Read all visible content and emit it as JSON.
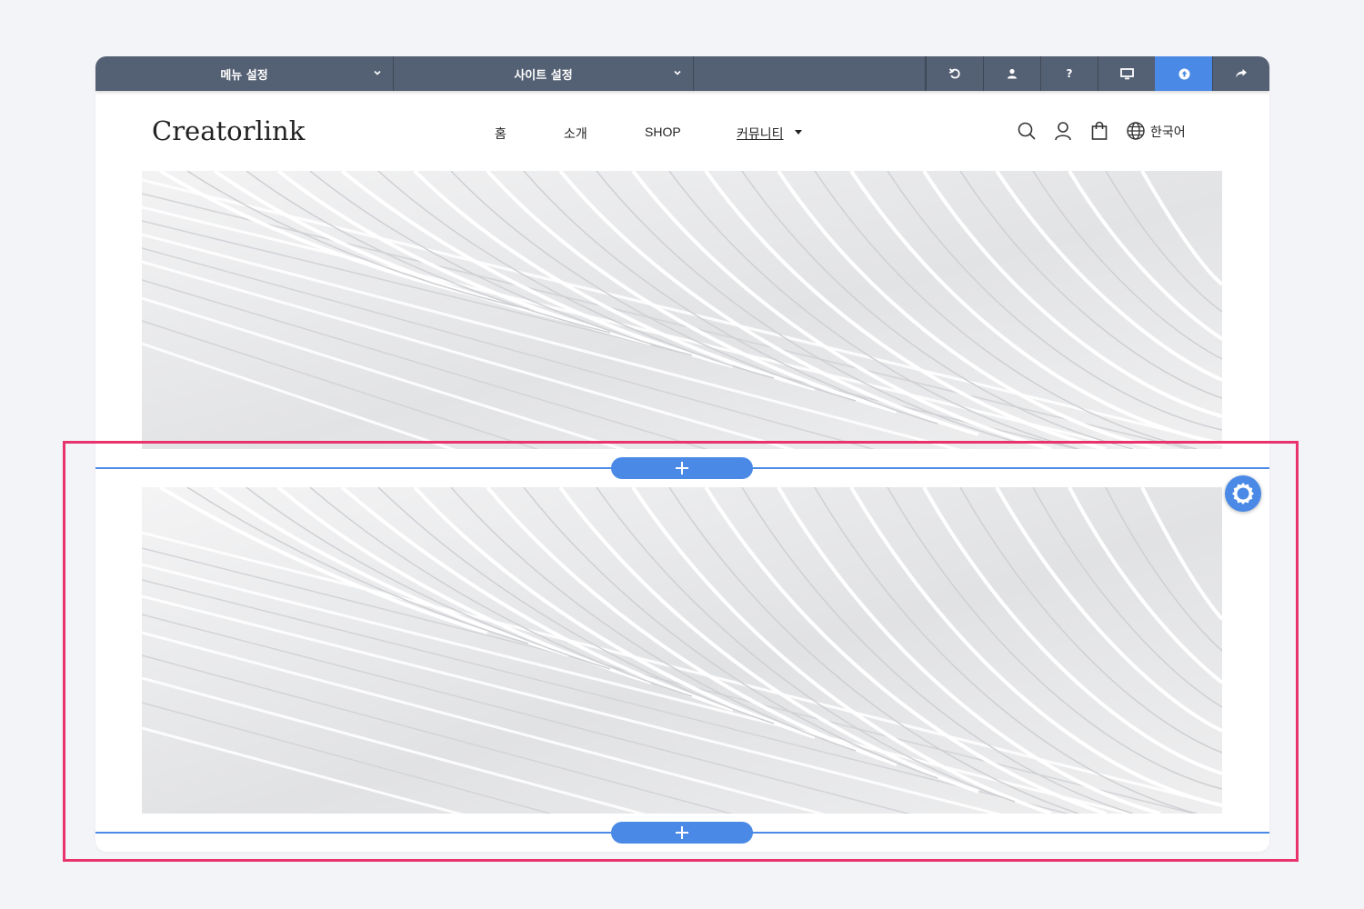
{
  "toolbar": {
    "menu_settings": "메뉴 설정",
    "site_settings": "사이트 설정",
    "help_label": "?",
    "buttons": [
      "undo-icon",
      "user-icon",
      "help-icon",
      "monitor-icon",
      "upload-icon",
      "share-icon"
    ],
    "active_button": "upload-icon"
  },
  "site": {
    "logo": "Creatorlink",
    "nav": [
      "홈",
      "소개",
      "SHOP",
      "커뮤니티"
    ],
    "language": "한국어"
  },
  "colors": {
    "toolbar_bg": "#546073",
    "accent": "#4a8ae6",
    "highlight": "#e8336d",
    "page_bg": "#f3f4f8"
  }
}
